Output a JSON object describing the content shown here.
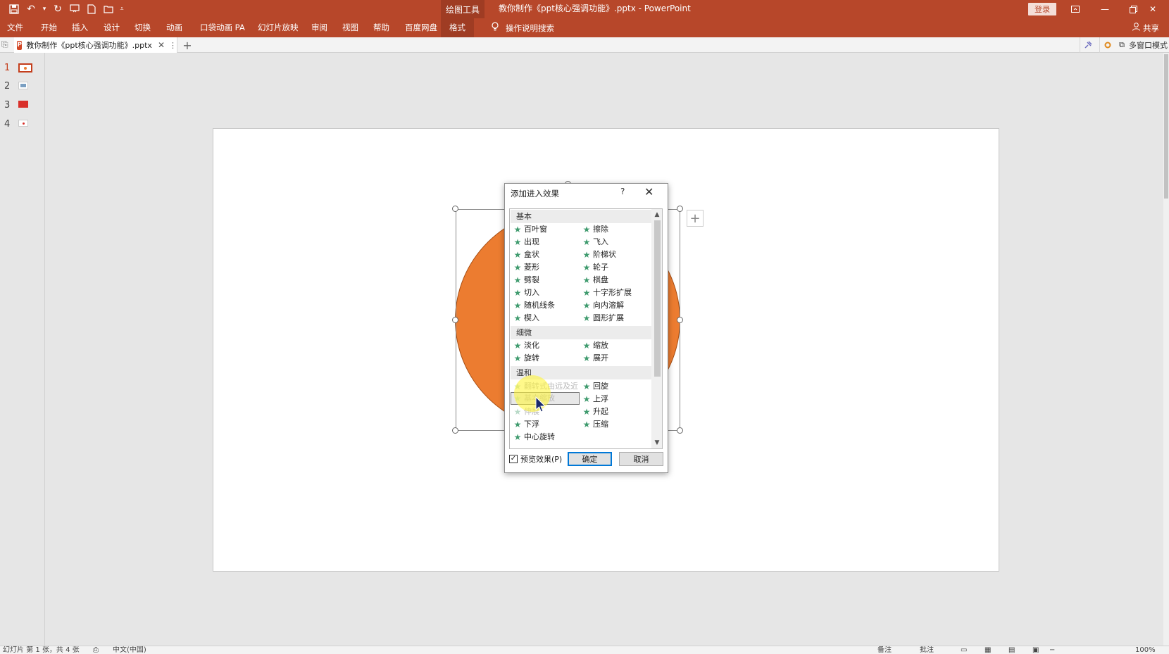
{
  "title_bar": {
    "context_tool": "绘图工具",
    "document_title": "教你制作《ppt核心强调功能》.pptx  -  PowerPoint",
    "login_label": "登录",
    "qat_icons": [
      "save-icon",
      "undo-icon",
      "dropdown-icon",
      "redo-icon",
      "start-from-beginning-icon",
      "new-file-icon",
      "open-folder-icon",
      "customize-qat-icon"
    ],
    "window_icons": [
      "ribbon-display-icon",
      "minimize-icon",
      "restore-icon",
      "close-icon"
    ]
  },
  "ribbon_tabs": [
    "文件",
    "开始",
    "插入",
    "设计",
    "切换",
    "动画",
    "口袋动画 PA",
    "幻灯片放映",
    "审阅",
    "视图",
    "帮助",
    "百度网盘",
    "格式"
  ],
  "active_tab": "格式",
  "tell_me": "操作说明搜索",
  "share_label": "共享",
  "doc_tab": {
    "label": "教你制作《ppt核心强调功能》.pptx",
    "close": "✕",
    "more": "⋮",
    "add": "+",
    "multi_window": "多窗口模式"
  },
  "slides": [
    {
      "num": "1"
    },
    {
      "num": "2"
    },
    {
      "num": "3"
    },
    {
      "num": "4"
    }
  ],
  "dialog": {
    "title": "添加进入效果",
    "help": "?",
    "close": "✕",
    "groups": {
      "basic": "基本",
      "subtle": "细微",
      "moderate": "温和"
    },
    "basic_items": [
      [
        "百叶窗",
        "擦除"
      ],
      [
        "出现",
        "飞入"
      ],
      [
        "盒状",
        "阶梯状"
      ],
      [
        "菱形",
        "轮子"
      ],
      [
        "劈裂",
        "棋盘"
      ],
      [
        "切入",
        "十字形扩展"
      ],
      [
        "随机线条",
        "向内溶解"
      ],
      [
        "楔入",
        "圆形扩展"
      ]
    ],
    "subtle_items": [
      [
        "淡化",
        "缩放"
      ],
      [
        "旋转",
        "展开"
      ]
    ],
    "moderate_items": [
      [
        "翻转式由远及近",
        "回旋"
      ],
      [
        "基本缩放",
        "上浮"
      ],
      [
        "伸展",
        "升起"
      ],
      [
        "下浮",
        "压缩"
      ],
      [
        "中心旋转",
        ""
      ]
    ],
    "selected_item": "基本缩放",
    "preview_label": "预览效果(P)",
    "preview_checked": true,
    "ok_label": "确定",
    "cancel_label": "取消"
  },
  "status_bar": {
    "slide_info": "幻灯片 第 1 张，共 4 张",
    "language": "中文(中国)",
    "notes": "备注",
    "comments": "批注",
    "zoom": "100%"
  },
  "colors": {
    "accent": "#b7472a",
    "shape_fill": "#ec7c30",
    "star": "#3f9b6e"
  }
}
